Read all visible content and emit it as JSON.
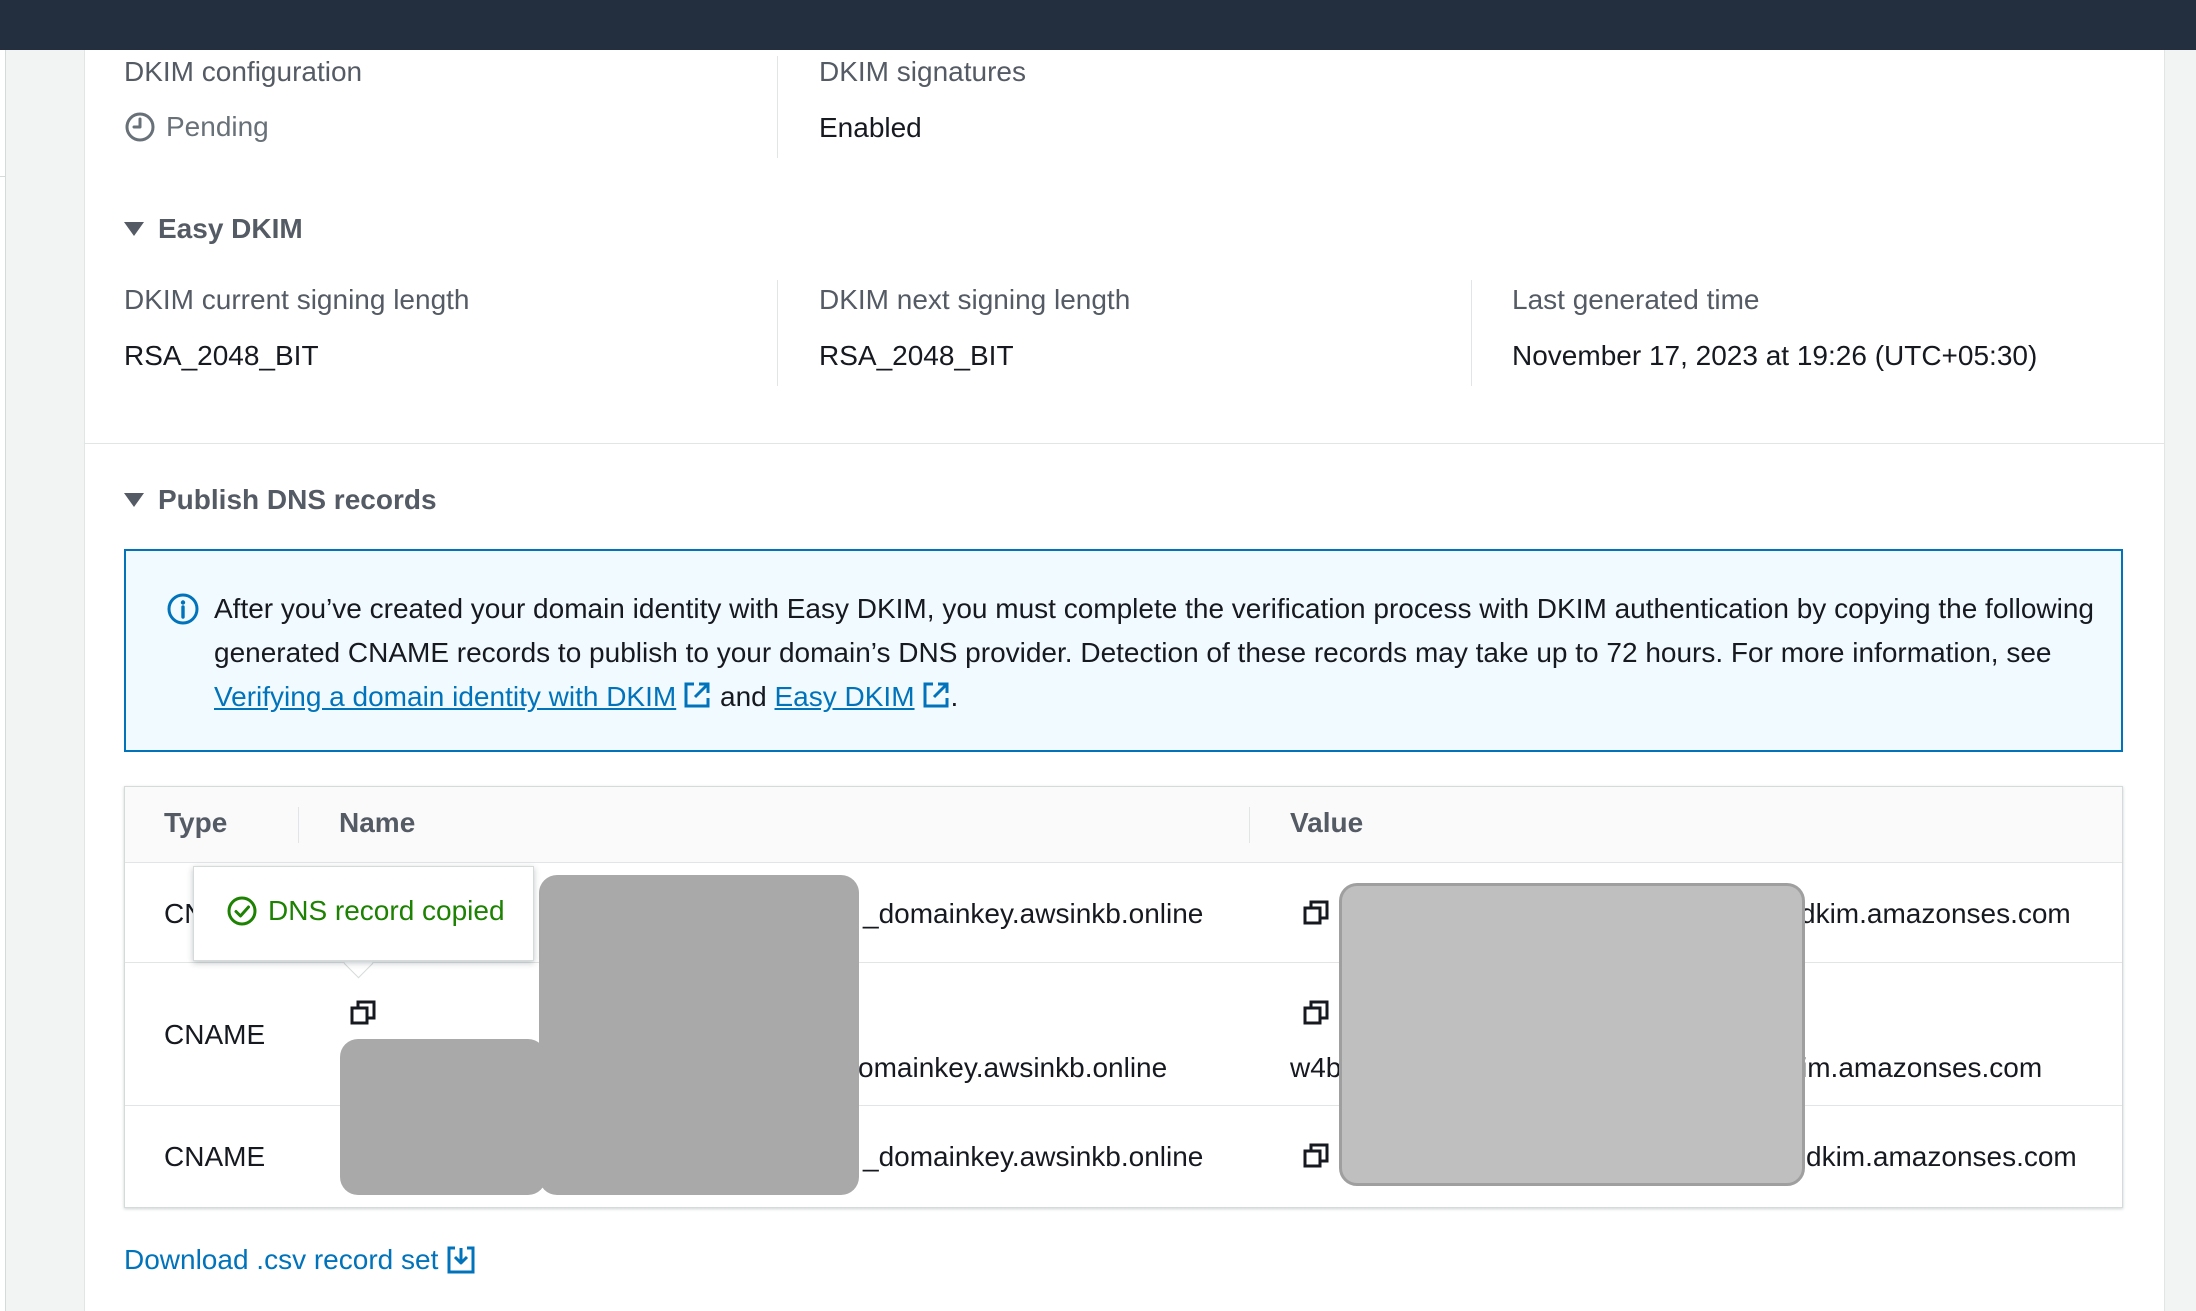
{
  "dkim_configuration": {
    "label": "DKIM configuration",
    "status": "Pending",
    "status_icon": "clock-icon"
  },
  "dkim_signatures": {
    "label": "DKIM signatures",
    "value": "Enabled"
  },
  "easy_dkim": {
    "title": "Easy DKIM",
    "current_length": {
      "label": "DKIM current signing length",
      "value": "RSA_2048_BIT"
    },
    "next_length": {
      "label": "DKIM next signing length",
      "value": "RSA_2048_BIT"
    },
    "last_generated": {
      "label": "Last generated time",
      "value": "November 17, 2023 at 19:26 (UTC+05:30)"
    }
  },
  "publish_dns": {
    "title": "Publish DNS records",
    "info": {
      "text_before": "After you’ve created your domain identity with Easy DKIM, you must complete the verification process with DKIM authentication by copying the following generated CNAME records to publish to your domain’s DNS provider. Detection of these records may take up to 72 hours. For more information, see ",
      "link1": "Verifying a domain identity with DKIM",
      "text_between": " and ",
      "link2": "Easy DKIM",
      "text_after": "."
    }
  },
  "table": {
    "headers": {
      "type": "Type",
      "name": "Name",
      "value": "Value"
    },
    "rows": [
      {
        "type": "CN",
        "name_suffix": "_domainkey.awsinkb.online",
        "value_suffix": "dkim.amazonses.com"
      },
      {
        "type": "CNAME",
        "name_suffix": "omainkey.awsinkb.online",
        "value_prefix": "w4b",
        "value_suffix": "im.amazonses.com"
      },
      {
        "type": "CNAME",
        "name_suffix": "_domainkey.awsinkb.online",
        "value_suffix": "dkim.amazonses.com"
      }
    ]
  },
  "popover": {
    "text": "DNS record copied",
    "icon": "check-circle-icon"
  },
  "download": {
    "label": "Download .csv record set",
    "icon": "download-icon"
  },
  "colors": {
    "link": "#0073bb",
    "success": "#1d8102",
    "info_border": "#0073bb",
    "topbar": "#232f3e"
  }
}
